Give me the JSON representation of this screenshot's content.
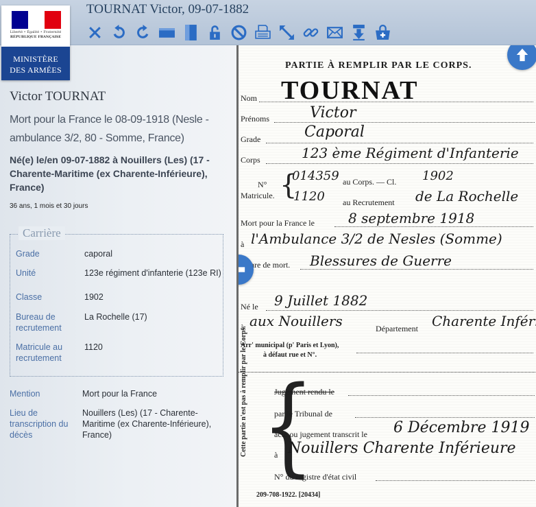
{
  "header": {
    "title": "TOURNAT Victor, 09-07-1882",
    "toolbar": [
      {
        "name": "close-icon",
        "color": "#2b6cc4"
      },
      {
        "name": "undo-icon",
        "color": "#2b6cc4"
      },
      {
        "name": "redo-icon",
        "color": "#2b6cc4"
      },
      {
        "name": "fit-width-icon",
        "color": "#2b6cc4"
      },
      {
        "name": "fit-height-icon",
        "color": "#2b6cc4"
      },
      {
        "name": "lock-icon",
        "color": "#2b6cc4"
      },
      {
        "name": "block-icon",
        "color": "#2b6cc4"
      },
      {
        "name": "print-icon",
        "color": "#2b6cc4"
      },
      {
        "name": "expand-icon",
        "color": "#2b6cc4"
      },
      {
        "name": "link-icon",
        "color": "#2b6cc4"
      },
      {
        "name": "mail-icon",
        "color": "#2b6cc4"
      },
      {
        "name": "download-icon",
        "color": "#2b6cc4"
      },
      {
        "name": "basket-icon",
        "color": "#2b6cc4"
      }
    ]
  },
  "logo": {
    "motto": "Liberté • Égalité • Fraternité",
    "republic": "RÉPUBLIQUE FRANÇAISE",
    "ministry_line1": "MINISTÈRE",
    "ministry_line2": "DES ARMÉES"
  },
  "person": {
    "name": "Victor TOURNAT",
    "death": "Mort pour la France le 08-09-1918 (Nesle - ambulance 3/2, 80 - Somme, France)",
    "birth": "Né(e) le/en 09-07-1882 à Nouillers (Les) (17 - Charente-Maritime (ex Charente-Inférieure), France)",
    "age": "36 ans, 1 mois et 30 jours"
  },
  "career": {
    "legend": "Carrière",
    "rows": [
      {
        "label": "Grade",
        "value": "caporal"
      },
      {
        "label": "Unité",
        "value": "123e régiment d'infanterie (123e RI)"
      },
      {
        "label": "Classe",
        "value": "1902"
      },
      {
        "label": "Bureau de recrutement",
        "value": "La Rochelle (17)"
      },
      {
        "label": "Matricule au recrutement",
        "value": "1120"
      }
    ]
  },
  "extra": [
    {
      "label": "Mention",
      "value": "Mort pour la France"
    },
    {
      "label": "Lieu de transcription du décès",
      "value": "Nouillers (Les) (17 - Charente-Maritime (ex Charente-Inférieure), France)"
    }
  ],
  "document": {
    "heading": "PARTIE À REMPLIR PAR LE CORPS.",
    "nom_label": "Nom",
    "nom_value": "TOURNAT",
    "prenoms_label": "Prénoms",
    "prenoms_value": "Victor",
    "grade_label": "Grade",
    "grade_value": "Caporal",
    "corps_label": "Corps",
    "corps_value": "123 ème Régiment d'Infanterie",
    "no_label": "N°",
    "matricule_label": "Matricule.",
    "corps_no_value": "014359",
    "au_corps_label": "au Corps. — Cl.",
    "classe_value": "1902",
    "recrut_no_value": "1120",
    "au_recrut_label": "au Recrutement",
    "recrut_value": "de La Rochelle",
    "mort_label": "Mort pour la France le",
    "mort_value": "8 septembre 1918",
    "a_label": "à",
    "lieu_value": "l'Ambulance 3/2 de Nesles (Somme)",
    "genre_label": "Genre de mort.",
    "genre_value": "Blessures de Guerre",
    "ne_label": "Né le",
    "ne_value": "9 Juillet 1882",
    "ne_a_label": "à",
    "ne_lieu_value": "aux Nouillers",
    "dept_label": "Département",
    "dept_value": "Charente Inférieure",
    "arr_label_1": "Arr' municipal (p' Paris et Lyon),",
    "arr_label_2": "à défaut rue et N°.",
    "side_text": "Cette partie n'est pas à remplir par le Corps.",
    "jugement_label": "Jugement rendu le",
    "tribunal_label": "par le Tribunal de",
    "acte_label": "acte ou jugement transcrit le",
    "acte_value": "6 Décembre 1919",
    "acte_a_label": "à",
    "acte_lieu_value": "Nouillers Charente Inférieure",
    "registre_label": "N° du registre d'état civil",
    "footer": "209-708-1922.   [20434]"
  }
}
